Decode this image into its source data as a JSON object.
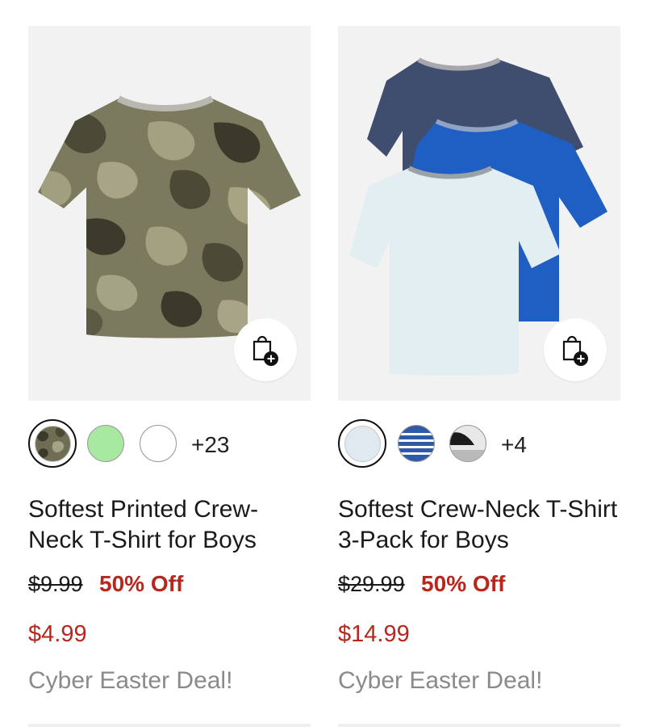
{
  "products": [
    {
      "title": "Softest Printed Crew-Neck T-Shirt for Boys",
      "original_price": "$9.99",
      "discount": "50% Off",
      "sale_price": "$4.99",
      "promo": "Cyber Easter Deal!",
      "more_colors": "+23",
      "swatches": [
        "camo",
        "light-green",
        "white"
      ],
      "selected_swatch": "camo",
      "add_to_bag_icon": "shopping-bag-plus-icon"
    },
    {
      "title": "Softest Crew-Neck T-Shirt 3-Pack for Boys",
      "original_price": "$29.99",
      "discount": "50% Off",
      "sale_price": "$14.99",
      "promo": "Cyber Easter Deal!",
      "more_colors": "+4",
      "swatches": [
        "light-blue",
        "blue-stripe",
        "gray-black"
      ],
      "selected_swatch": "light-blue",
      "add_to_bag_icon": "shopping-bag-plus-icon"
    }
  ],
  "colors": {
    "sale_red": "#b8261c",
    "promo_gray": "#8a8a8a",
    "image_bg": "#f2f2f2"
  }
}
